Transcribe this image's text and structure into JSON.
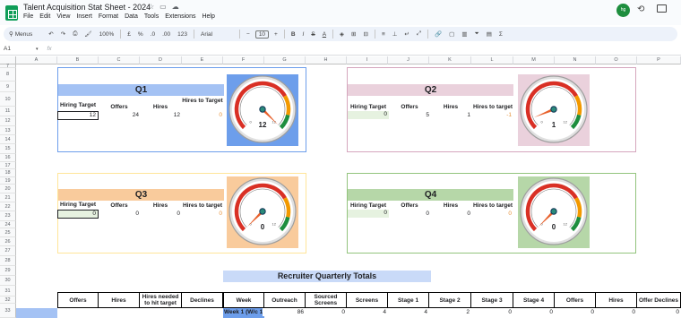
{
  "app": {
    "title": "Talent Acquisition Stat Sheet - 2024",
    "menu": [
      "File",
      "Edit",
      "View",
      "Insert",
      "Format",
      "Data",
      "Tools",
      "Extensions",
      "Help"
    ],
    "avatar_text": "hg"
  },
  "toolbar": {
    "menus_label": "Menus",
    "zoom": "100%",
    "currency": "£",
    "percent": "%",
    "dec_decrease": ".0",
    "dec_increase": ".00",
    "number_format": "123",
    "font": "Arial",
    "font_size": "10"
  },
  "formula_bar": {
    "cell_ref": "A1",
    "fx": "fx",
    "value": ""
  },
  "columns": [
    "A",
    "B",
    "C",
    "D",
    "E",
    "F",
    "G",
    "H",
    "I",
    "J",
    "K",
    "L",
    "M",
    "N",
    "O",
    "P"
  ],
  "rows": [
    "7",
    "8",
    "9",
    "10",
    "11",
    "12",
    "13",
    "14",
    "15",
    "16",
    "17",
    "18",
    "19",
    "20",
    "21",
    "22",
    "23",
    "24",
    "25",
    "26",
    "27",
    "28",
    "29",
    "30",
    "31",
    "32",
    "33"
  ],
  "quarters": [
    {
      "label": "Q1",
      "headers": [
        "Hiring Target",
        "Offers",
        "Hires",
        "Hires to Target"
      ],
      "values": [
        "12",
        "24",
        "12",
        "0"
      ],
      "gauge_value": "12",
      "accent": "#6d9eeb"
    },
    {
      "label": "Q2",
      "headers": [
        "Hiring Target",
        "Offers",
        "Hires",
        "Hires to target"
      ],
      "values": [
        "0",
        "5",
        "1",
        "-1"
      ],
      "gauge_value": "1",
      "accent": "#ead1dc"
    },
    {
      "label": "Q3",
      "headers": [
        "Hiring Target",
        "Offers",
        "Hires",
        "Hires to target"
      ],
      "values": [
        "0",
        "0",
        "0",
        "0"
      ],
      "gauge_value": "0",
      "accent": "#f9cb9c"
    },
    {
      "label": "Q4",
      "headers": [
        "Hiring Target",
        "Offers",
        "Hires",
        "Hires to target"
      ],
      "values": [
        "0",
        "0",
        "0",
        "0"
      ],
      "gauge_value": "0",
      "accent": "#b6d7a8"
    }
  ],
  "gauge_scale": {
    "min": "0",
    "max": "12"
  },
  "recruiter_totals": {
    "title": "Recruiter Quarterly Totals",
    "left_headers": [
      "Offers",
      "Hires",
      "Hires needed to hit target",
      "Declines"
    ],
    "right_headers": [
      "Week",
      "Outreach",
      "Sourced Screens",
      "Screens",
      "Stage 1",
      "Stage 2",
      "Stage 3",
      "Stage 4",
      "Offers",
      "Hires",
      "Offer Declines"
    ],
    "row": [
      "Week 1 (W/c 1s",
      "86",
      "0",
      "4",
      "4",
      "2",
      "0",
      "0",
      "0",
      "0",
      "0"
    ]
  }
}
